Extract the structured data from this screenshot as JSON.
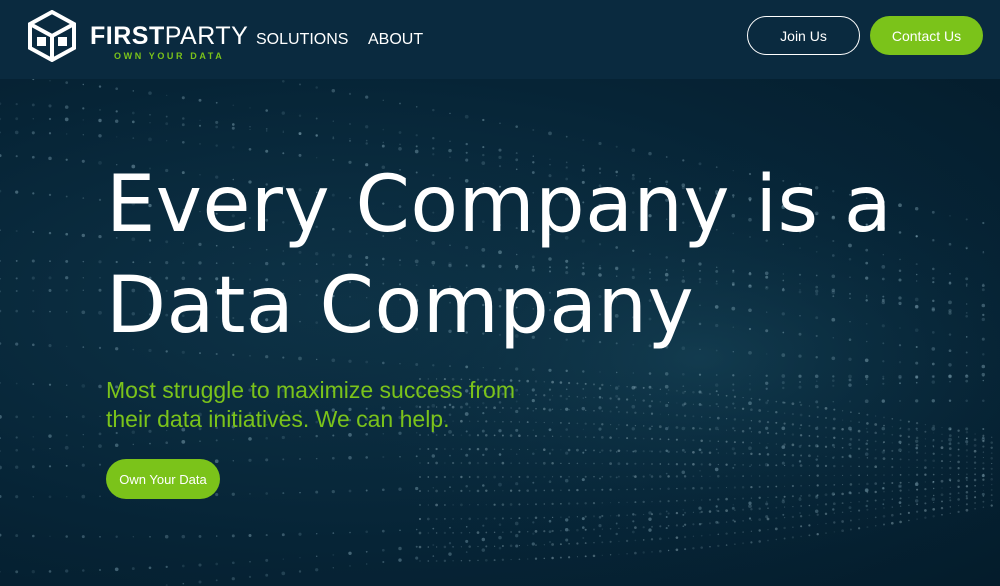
{
  "brand": {
    "name_bold": "FIRST",
    "name_light": "PARTY",
    "tagline": "OWN YOUR DATA",
    "logo_icon": "cube-logo-icon",
    "accent_color": "#7bc31a"
  },
  "nav": {
    "items": [
      {
        "label": "SOLUTIONS"
      },
      {
        "label": "ABOUT"
      }
    ]
  },
  "header_actions": {
    "join_label": "Join Us",
    "contact_label": "Contact Us"
  },
  "hero": {
    "title_line1": "Every Company is a",
    "title_line2": "Data Company",
    "subtitle_line1": "Most struggle to maximize success from",
    "subtitle_line2": "their data initiatives. We can help.",
    "cta_label": "Own Your Data",
    "background": "data-particle-waves"
  }
}
